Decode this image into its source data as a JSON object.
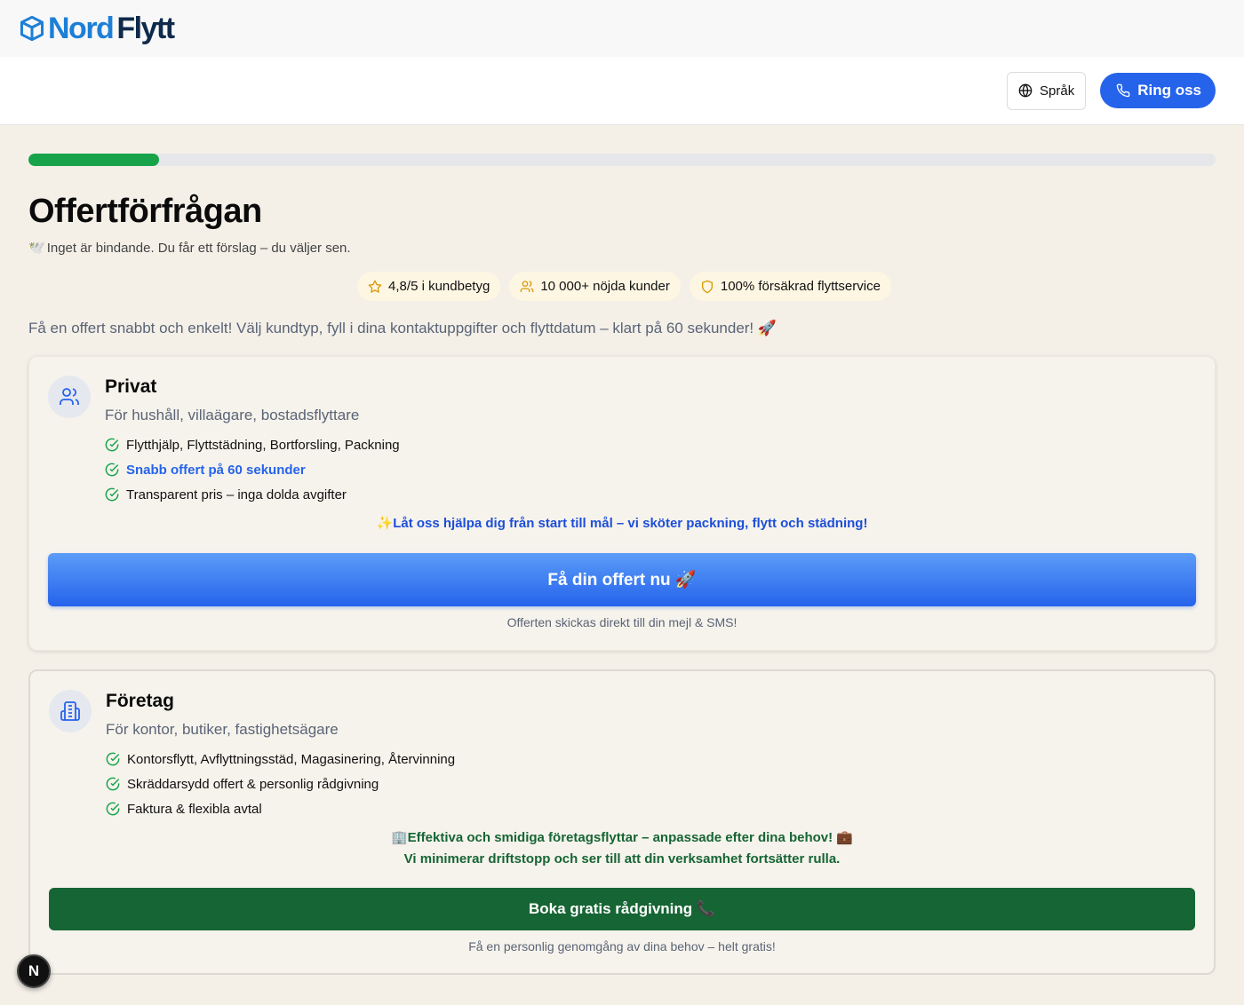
{
  "brand": {
    "name_part1": "Nord",
    "name_part2": "Flytt"
  },
  "nav": {
    "language_label": "Språk",
    "call_label": "Ring oss"
  },
  "progress": {
    "percent": 11
  },
  "page": {
    "title": "Offertförfrågan",
    "subtitle_emoji": "🕊️",
    "subtitle": "Inget är bindande. Du får ett förslag – du väljer sen.",
    "intro": "Få en offert snabbt och enkelt! Välj kundtyp, fyll i dina kontaktuppgifter och flyttdatum – klart på 60 sekunder! 🚀"
  },
  "badges": [
    {
      "icon": "star-icon",
      "label": "4,8/5 i kundbetyg"
    },
    {
      "icon": "users-icon",
      "label": "10 000+ nöjda kunder"
    },
    {
      "icon": "shield-icon",
      "label": "100% försäkrad flyttservice"
    }
  ],
  "private": {
    "title": "Privat",
    "subtitle": "För hushåll, villaägare, bostadsflyttare",
    "features": [
      "Flytthjälp, Flyttstädning, Bortforsling, Packning",
      "Snabb offert på 60 sekunder",
      "Transparent pris – inga dolda avgifter"
    ],
    "promo": "✨Låt oss hjälpa dig från start till mål – vi sköter packning, flytt och städning!",
    "cta": "Få din offert nu 🚀",
    "note": "Offerten skickas direkt till din mejl & SMS!"
  },
  "business": {
    "title": "Företag",
    "subtitle": "För kontor, butiker, fastighetsägare",
    "features": [
      "Kontorsflytt, Avflyttningsstäd, Magasinering, Återvinning",
      "Skräddarsydd offert & personlig rådgivning",
      "Faktura & flexibla avtal"
    ],
    "promo_line1": "🏢Effektiva och smidiga företagsflyttar – anpassade efter dina behov! 💼",
    "promo_line2": "Vi minimerar driftstopp och ser till att din verksamhet fortsätter rulla.",
    "cta": "Boka gratis rådgivning 📞",
    "note": "Få en personlig genomgång av dina behov – helt gratis!"
  },
  "colors": {
    "primary": "#2563eb",
    "success": "#16a34a",
    "business": "#166534",
    "background": "#f4f0e8"
  },
  "dev_badge": "N"
}
